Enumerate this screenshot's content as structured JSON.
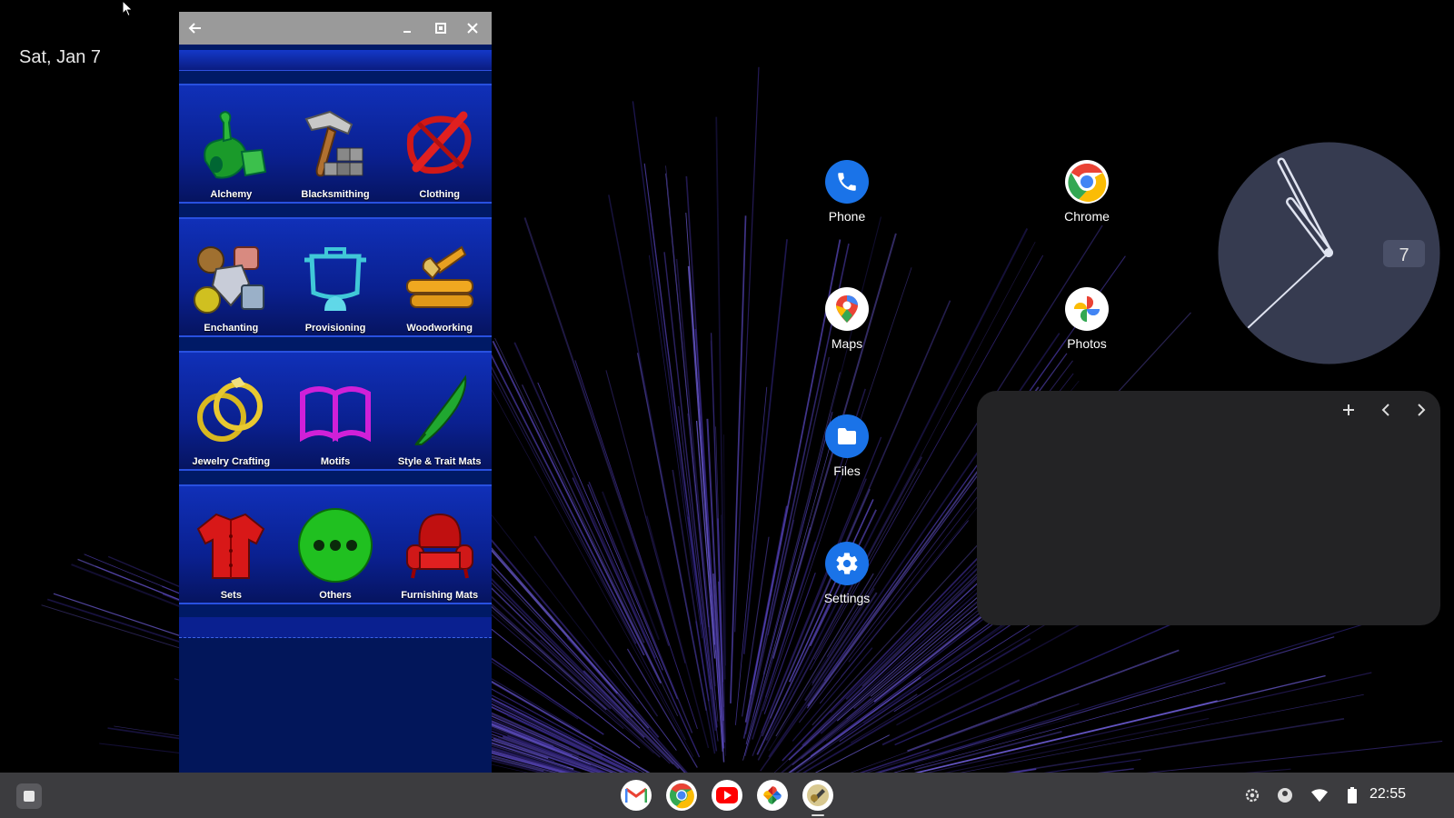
{
  "desktop": {
    "date": "Sat, Jan 7"
  },
  "window": {
    "rows": [
      [
        {
          "label": "Alchemy",
          "icon": "alchemy-icon"
        },
        {
          "label": "Blacksmithing",
          "icon": "blacksmithing-icon"
        },
        {
          "label": "Clothing",
          "icon": "clothing-icon"
        }
      ],
      [
        {
          "label": "Enchanting",
          "icon": "enchanting-icon"
        },
        {
          "label": "Provisioning",
          "icon": "provisioning-icon"
        },
        {
          "label": "Woodworking",
          "icon": "woodworking-icon"
        }
      ],
      [
        {
          "label": "Jewelry Crafting",
          "icon": "jewelry-crafting-icon"
        },
        {
          "label": "Motifs",
          "icon": "motifs-icon"
        },
        {
          "label": "Style & Trait Mats",
          "icon": "style-trait-mats-icon"
        }
      ],
      [
        {
          "label": "Sets",
          "icon": "sets-icon"
        },
        {
          "label": "Others",
          "icon": "others-icon"
        },
        {
          "label": "Furnishing Mats",
          "icon": "furnishing-mats-icon"
        }
      ]
    ]
  },
  "shortcuts": [
    {
      "label": "Phone",
      "icon": "phone-icon"
    },
    {
      "label": "Chrome",
      "icon": "chrome-icon"
    },
    {
      "label": "Maps",
      "icon": "maps-icon"
    },
    {
      "label": "Photos",
      "icon": "photos-icon"
    },
    {
      "label": "Files",
      "icon": "files-icon"
    },
    {
      "label": "Settings",
      "icon": "settings-icon"
    }
  ],
  "clock": {
    "day": "7"
  },
  "shelf": {
    "time": "22:55"
  },
  "colors": {
    "window_bg": "#001a66",
    "row_border": "#2850e0",
    "shelf": "#3c3c3f",
    "calendar": "#232325"
  }
}
